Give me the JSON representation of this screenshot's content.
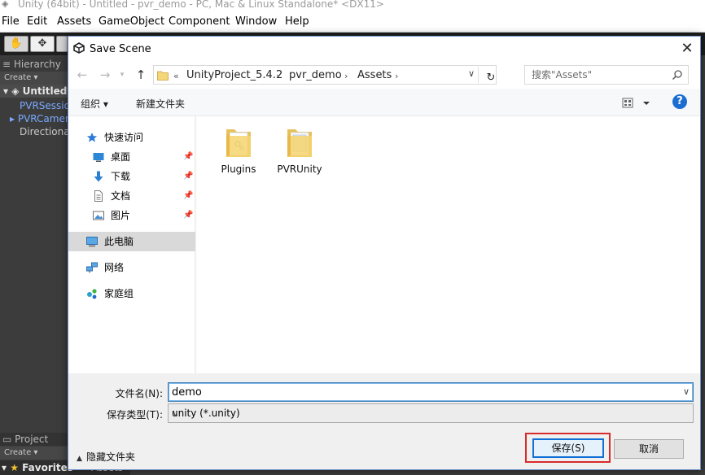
{
  "unity": {
    "title": "Unity (64bit) - Untitled - pvr_demo - PC, Mac & Linux Standalone* <DX11>",
    "menu": [
      "File",
      "Edit",
      "Assets",
      "GameObject",
      "Component",
      "Window",
      "Help"
    ],
    "hierarchy_tab": "Hierarchy",
    "create_label": "Create ▾",
    "scene_name": "Untitled*",
    "hierarchy_items": [
      "PVRSession",
      "PVRCamera",
      "Directional"
    ],
    "project_tab": "Project",
    "favorites_label": "Favorites",
    "assets_partial": "Assets"
  },
  "dialog": {
    "title": "Save Scene",
    "close_glyph": "✕",
    "breadcrumb": {
      "prefix": "«",
      "parts": [
        "UnityProject_5.4.2",
        "pvr_demo",
        "Assets"
      ]
    },
    "search_placeholder": "搜索\"Assets\"",
    "commands": {
      "organize": "组织 ▾",
      "new_folder": "新建文件夹",
      "help": "?"
    },
    "nav": [
      {
        "label": "快速访问",
        "icon": "star-icon"
      },
      {
        "label": "桌面",
        "icon": "desktop-icon",
        "pinned": true
      },
      {
        "label": "下载",
        "icon": "download-icon",
        "pinned": true
      },
      {
        "label": "文档",
        "icon": "document-icon",
        "pinned": true
      },
      {
        "label": "图片",
        "icon": "picture-icon",
        "pinned": true
      },
      {
        "label": "此电脑",
        "icon": "computer-icon",
        "selected": true
      },
      {
        "label": "网络",
        "icon": "network-icon"
      },
      {
        "label": "家庭组",
        "icon": "homegroup-icon"
      }
    ],
    "files": [
      {
        "name": "Plugins",
        "icon": "folder-icon"
      },
      {
        "name": "PVRUnity",
        "icon": "folder-icon"
      }
    ],
    "filename_label": "文件名(N):",
    "filename_value": "demo",
    "filetype_label": "保存类型(T):",
    "filetype_value": "unity (*.unity)",
    "hide_folders_label": "隐藏文件夹",
    "save_label": "保存(S)",
    "cancel_label": "取消"
  },
  "colors": {
    "accent": "#0f6fd6",
    "highlight": "#d92b2b",
    "help_blue": "#1c6fd0"
  }
}
